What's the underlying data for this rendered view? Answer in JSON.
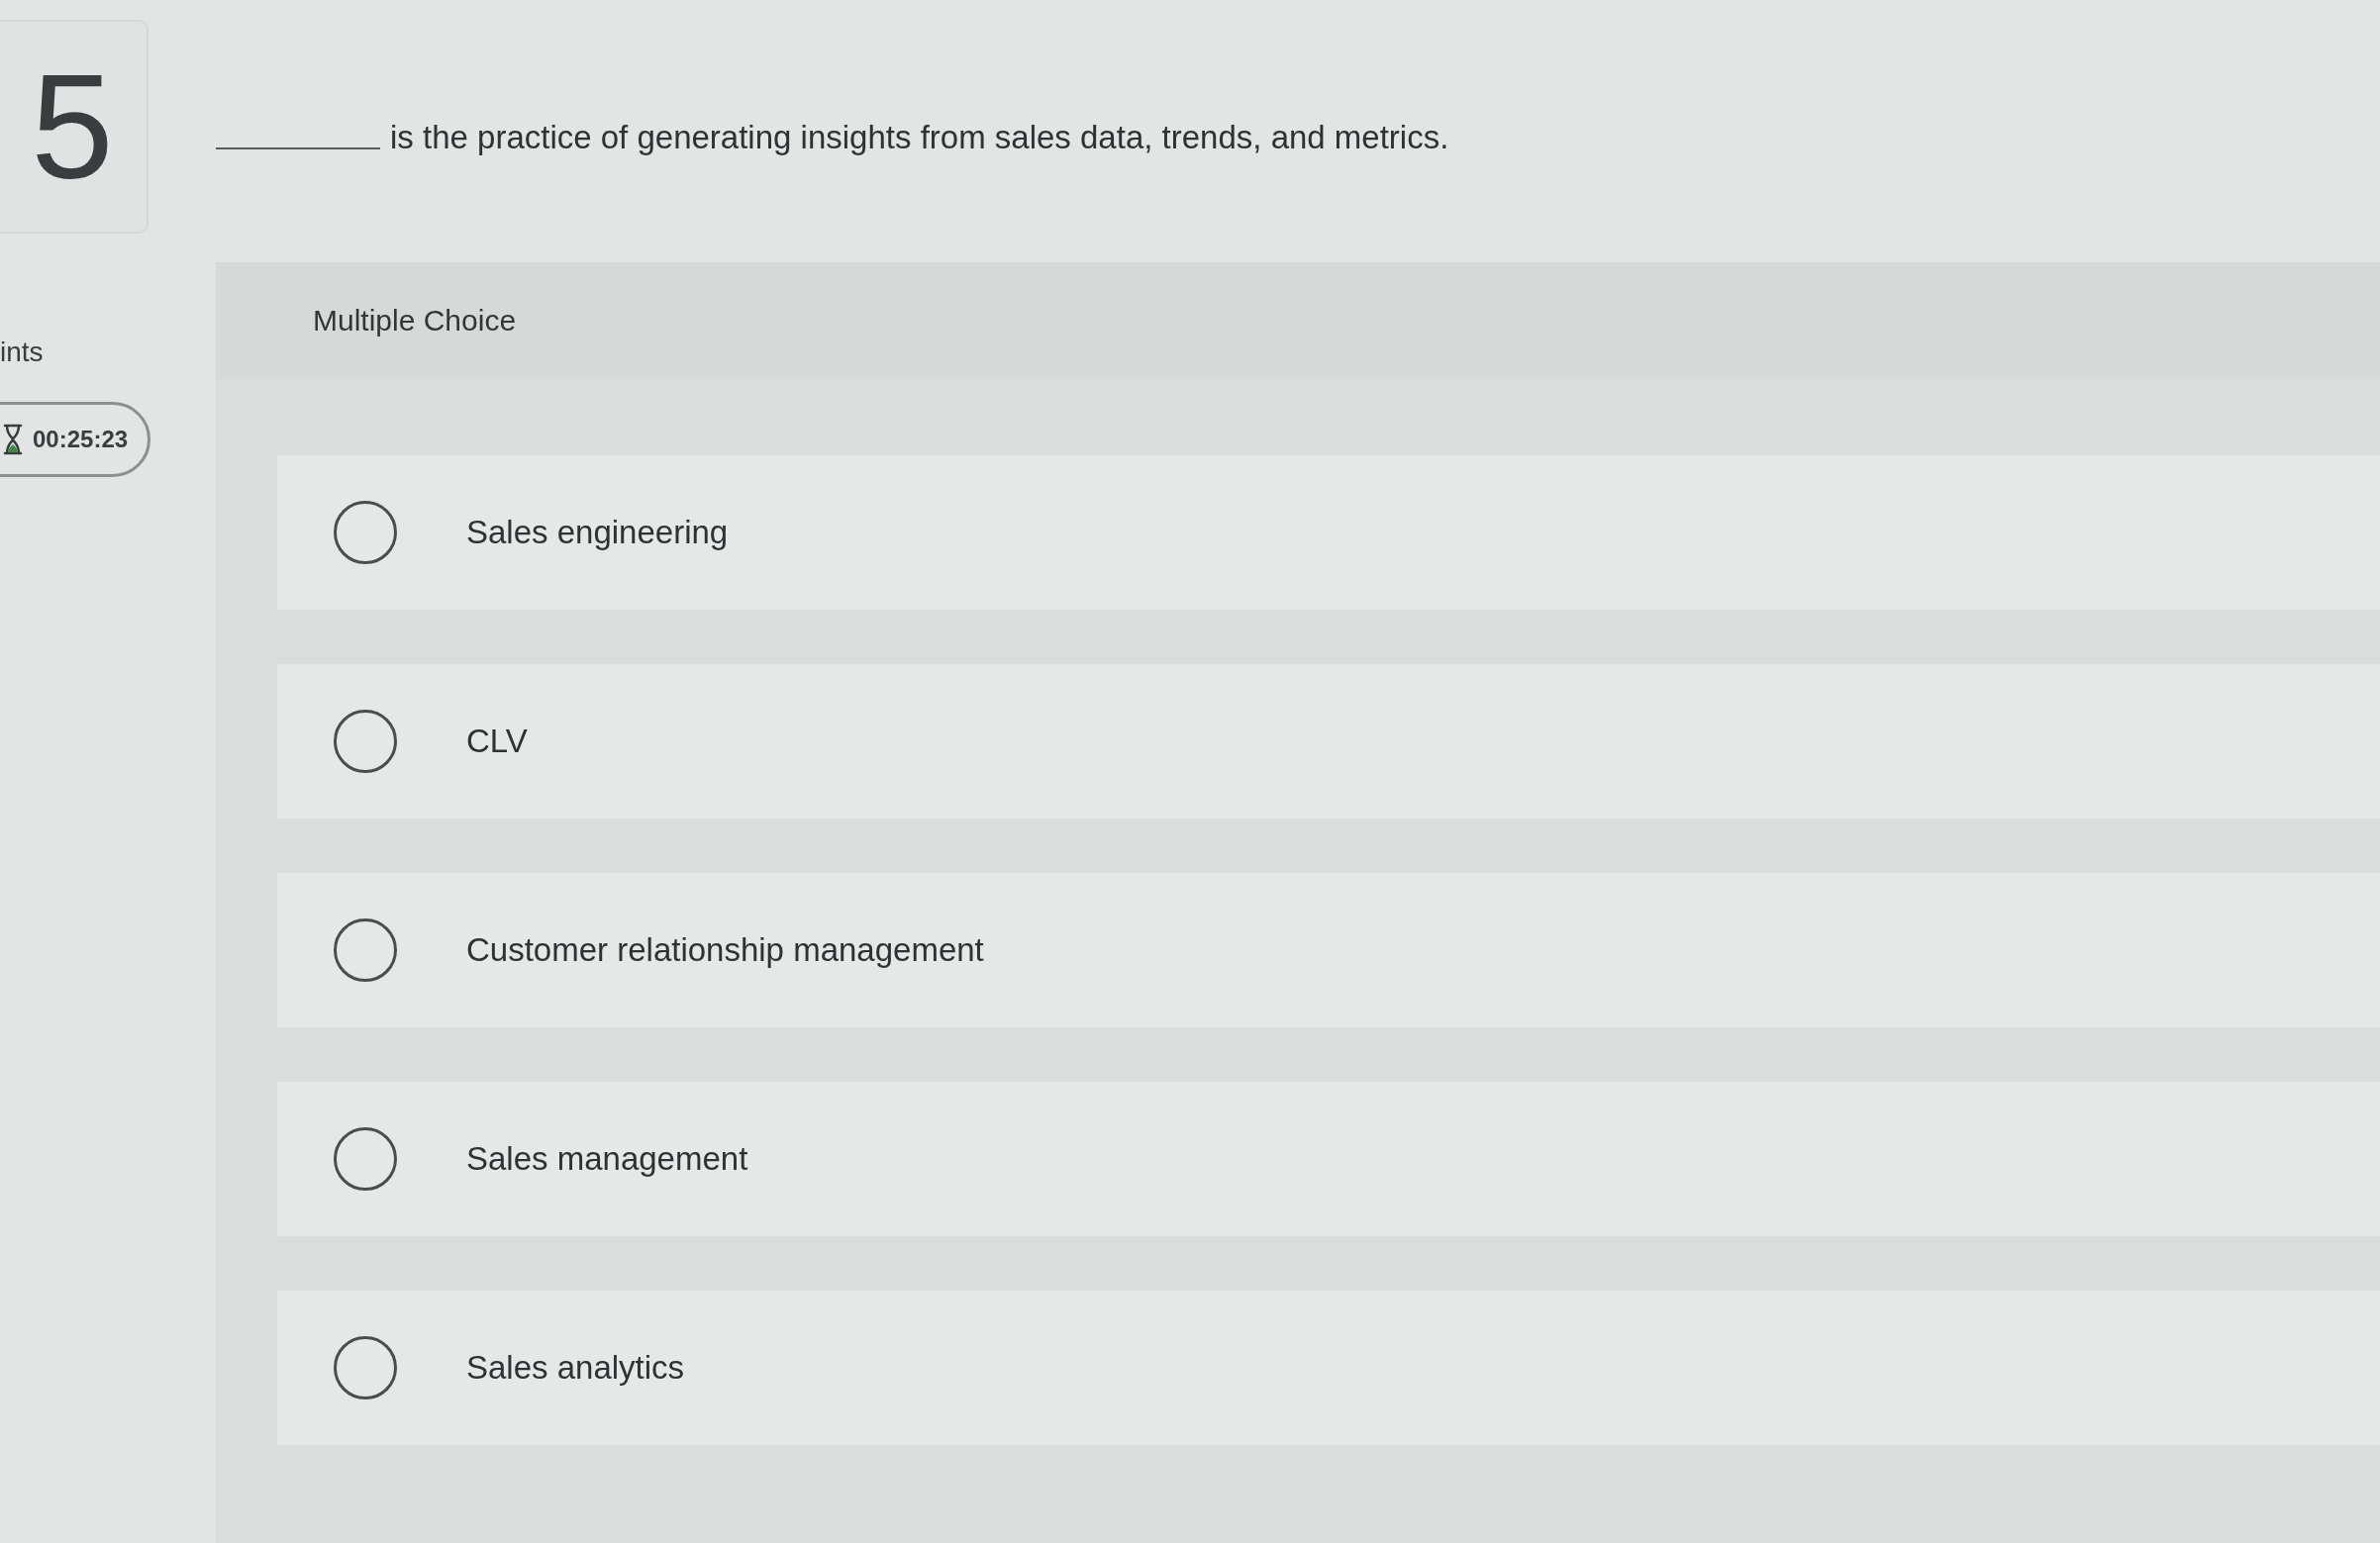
{
  "sidebar": {
    "question_number": "5",
    "points_label": "ints",
    "timer": "00:25:23"
  },
  "question": {
    "text": "is the practice of generating insights from sales data, trends, and metrics."
  },
  "answer_panel": {
    "type_label": "Multiple Choice",
    "options": [
      {
        "label": "Sales engineering",
        "selected": false
      },
      {
        "label": "CLV",
        "selected": false
      },
      {
        "label": "Customer relationship management",
        "selected": false
      },
      {
        "label": "Sales management",
        "selected": false
      },
      {
        "label": "Sales analytics",
        "selected": false
      }
    ]
  }
}
